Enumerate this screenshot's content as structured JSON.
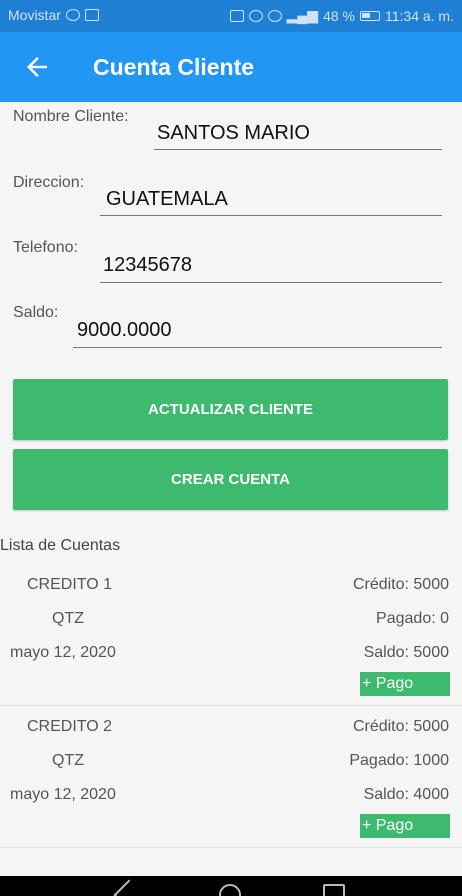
{
  "status_bar": {
    "carrier": "Movistar",
    "battery": "48 %",
    "time": "11:34 a. m."
  },
  "app_bar": {
    "title": "Cuenta Cliente"
  },
  "form": {
    "nombre": {
      "label": "Nombre Cliente:",
      "value": "SANTOS MARIO"
    },
    "direccion": {
      "label": "Direccion:",
      "value": "GUATEMALA"
    },
    "telefono": {
      "label": "Telefono:",
      "value": "12345678"
    },
    "saldo": {
      "label": "Saldo:",
      "value": "9000.0000"
    }
  },
  "buttons": {
    "actualizar": "ACTUALIZAR CLIENTE",
    "crear": "CREAR CUENTA"
  },
  "list": {
    "title": "Lista de Cuentas",
    "accounts": [
      {
        "name": "CREDITO 1",
        "currency": "QTZ",
        "date": "mayo 12, 2020",
        "credito": "Crédito: 5000",
        "pagado": "Pagado: 0",
        "saldo": "Saldo: 5000",
        "pago_label": "+ Pago"
      },
      {
        "name": "CREDITO 2",
        "currency": "QTZ",
        "date": "mayo 12, 2020",
        "credito": "Crédito: 5000",
        "pagado": "Pagado: 1000",
        "saldo": "Saldo: 4000",
        "pago_label": "+ Pago"
      }
    ]
  }
}
